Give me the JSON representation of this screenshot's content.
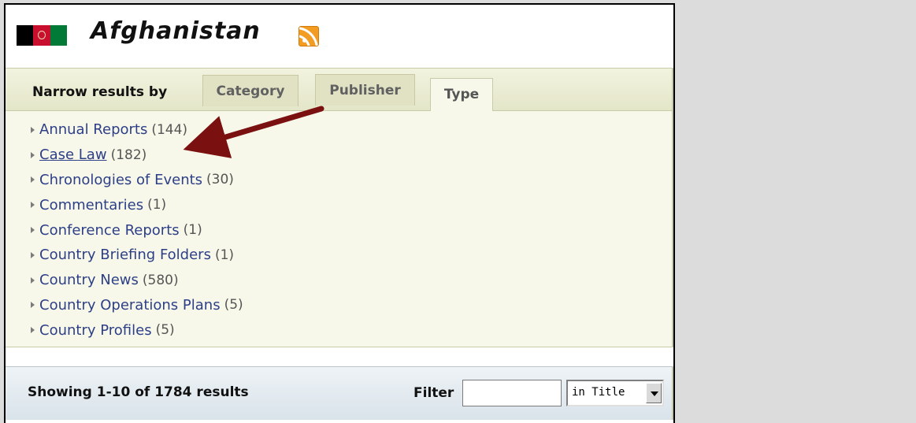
{
  "country": {
    "title": "Afghanistan",
    "flag_icon": "afghanistan-flag-icon",
    "rss_icon": "rss-feed-icon"
  },
  "narrow": {
    "label": "Narrow results by",
    "tabs": [
      {
        "label": "Category",
        "selected": false
      },
      {
        "label": "Publisher",
        "selected": false
      },
      {
        "label": "Type",
        "selected": true
      }
    ]
  },
  "types": [
    {
      "label": "Annual Reports",
      "count": "(144)"
    },
    {
      "label": "Case Law",
      "count": "(182)"
    },
    {
      "label": "Chronologies of Events",
      "count": "(30)"
    },
    {
      "label": "Commentaries",
      "count": "(1)"
    },
    {
      "label": "Conference Reports",
      "count": "(1)"
    },
    {
      "label": "Country Briefing Folders",
      "count": "(1)"
    },
    {
      "label": "Country News",
      "count": "(580)"
    },
    {
      "label": "Country Operations Plans",
      "count": "(5)"
    },
    {
      "label": "Country Profiles",
      "count": "(5)"
    }
  ],
  "results": {
    "summary": "Showing 1-10 of 1784 results",
    "filter_label": "Filter",
    "filter_value": "",
    "filter_scope": "in Title"
  },
  "colors": {
    "link": "#2d3f87",
    "panel_bg": "#f7f8ea",
    "arrow": "#7a1010",
    "rss": "#f29c22"
  }
}
